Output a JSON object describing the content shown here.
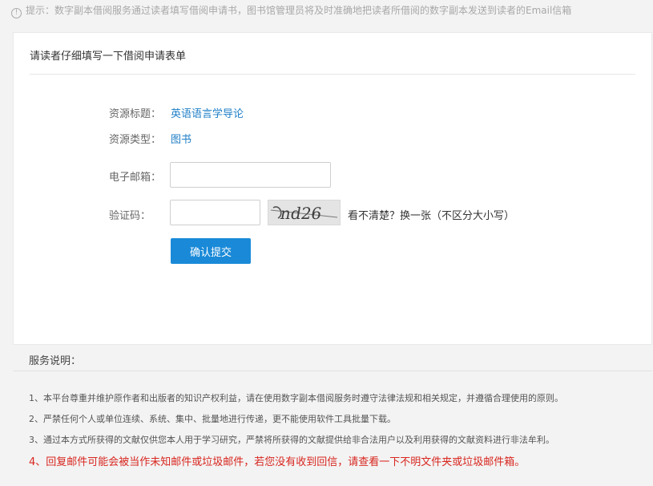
{
  "tip": {
    "icon": "info-circle-icon",
    "text": "提示：数字副本借阅服务通过读者填写借阅申请书，图书馆管理员将及时准确地把读者所借阅的数字副本发送到读者的Email信箱"
  },
  "form": {
    "title": "请读者仔细填写一下借阅申请表单",
    "resource_title_label": "资源标题：",
    "resource_title_value": "英语语言学导论",
    "resource_type_label": "资源类型：",
    "resource_type_value": "图书",
    "email_label": "电子邮箱：",
    "email_value": "",
    "captcha_label": "验证码：",
    "captcha_value": "",
    "captcha_text": "nd26",
    "refresh_text": "看不清楚？换一张（不区分大小写）",
    "submit_label": "确认提交"
  },
  "notes": {
    "title": "服务说明：",
    "items": [
      "1、本平台尊重并维护原作者和出版者的知识产权利益，请在使用数字副本借阅服务时遵守法律法规和相关规定，并遵循合理使用的原则。",
      "2、严禁任何个人或单位连续、系统、集中、批量地进行传递，更不能使用软件工具批量下载。",
      "3、通过本方式所获得的文献仅供您本人用于学习研究，严禁将所获得的文献提供给非合法用户以及利用获得的文献资料进行非法牟利。",
      "4、回复邮件可能会被当作未知邮件或垃圾邮件，若您没有收到回信，请查看一下不明文件夹或垃圾邮件箱。"
    ]
  },
  "colors": {
    "accent": "#1a8ad8",
    "link": "#1f7fc7",
    "warning": "#d8261f"
  }
}
